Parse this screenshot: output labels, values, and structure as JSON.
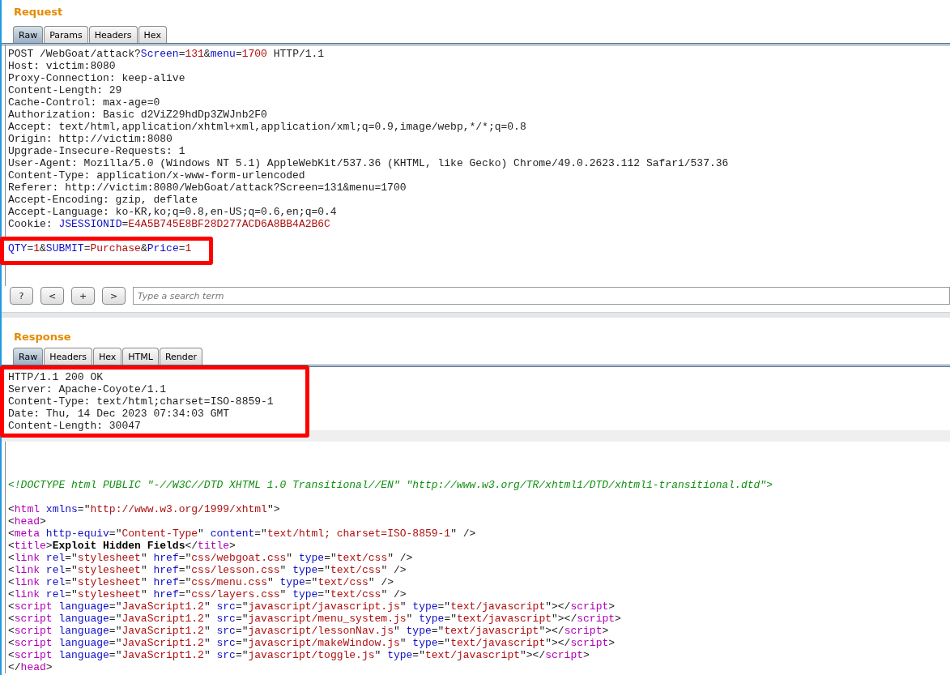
{
  "request": {
    "title": "Request",
    "tabs": [
      {
        "label": "Raw",
        "selected": true
      },
      {
        "label": "Params",
        "selected": false
      },
      {
        "label": "Headers",
        "selected": false
      },
      {
        "label": "Hex",
        "selected": false
      }
    ],
    "header_lines": [
      [
        {
          "kind": "plain",
          "text": "POST /WebGoat/attack?"
        },
        {
          "kind": "key",
          "text": "Screen"
        },
        {
          "kind": "plain",
          "text": "="
        },
        {
          "kind": "value",
          "text": "131"
        },
        {
          "kind": "plain",
          "text": "&"
        },
        {
          "kind": "key",
          "text": "menu"
        },
        {
          "kind": "plain",
          "text": "="
        },
        {
          "kind": "value",
          "text": "1700"
        },
        {
          "kind": "plain",
          "text": " HTTP/1.1"
        }
      ],
      [
        {
          "kind": "plain",
          "text": "Host: victim:8080"
        }
      ],
      [
        {
          "kind": "plain",
          "text": "Proxy-Connection: keep-alive"
        }
      ],
      [
        {
          "kind": "plain",
          "text": "Content-Length: 29"
        }
      ],
      [
        {
          "kind": "plain",
          "text": "Cache-Control: max-age=0"
        }
      ],
      [
        {
          "kind": "plain",
          "text": "Authorization: Basic d2ViZ29hdDp3ZWJnb2F0"
        }
      ],
      [
        {
          "kind": "plain",
          "text": "Accept: text/html,application/xhtml+xml,application/xml;q=0.9,image/webp,*/*;q=0.8"
        }
      ],
      [
        {
          "kind": "plain",
          "text": "Origin: http://victim:8080"
        }
      ],
      [
        {
          "kind": "plain",
          "text": "Upgrade-Insecure-Requests: 1"
        }
      ],
      [
        {
          "kind": "plain",
          "text": "User-Agent: Mozilla/5.0 (Windows NT 5.1) AppleWebKit/537.36 (KHTML, like Gecko) Chrome/49.0.2623.112 Safari/537.36"
        }
      ],
      [
        {
          "kind": "plain",
          "text": "Content-Type: application/x-www-form-urlencoded"
        }
      ],
      [
        {
          "kind": "plain",
          "text": "Referer: http://victim:8080/WebGoat/attack?Screen=131&menu=1700"
        }
      ],
      [
        {
          "kind": "plain",
          "text": "Accept-Encoding: gzip, deflate"
        }
      ],
      [
        {
          "kind": "plain",
          "text": "Accept-Language: ko-KR,ko;q=0.8,en-US;q=0.6,en;q=0.4"
        }
      ],
      [
        {
          "kind": "plain",
          "text": "Cookie: "
        },
        {
          "kind": "key",
          "text": "JSESSIONID"
        },
        {
          "kind": "plain",
          "text": "="
        },
        {
          "kind": "value",
          "text": "E4A5B745E8BF28D277ACD6A8BB4A2B6C"
        }
      ]
    ],
    "body_lines": [
      [
        {
          "kind": "key",
          "text": "QTY"
        },
        {
          "kind": "plain",
          "text": "="
        },
        {
          "kind": "value",
          "text": "1"
        },
        {
          "kind": "plain",
          "text": "&"
        },
        {
          "kind": "key",
          "text": "SUBMIT"
        },
        {
          "kind": "plain",
          "text": "="
        },
        {
          "kind": "value",
          "text": "Purchase"
        },
        {
          "kind": "plain",
          "text": "&"
        },
        {
          "kind": "key",
          "text": "Price"
        },
        {
          "kind": "plain",
          "text": "="
        },
        {
          "kind": "value",
          "text": "1"
        }
      ]
    ]
  },
  "toolbar": {
    "buttons": [
      "?",
      "<",
      "+",
      ">"
    ],
    "search": {
      "placeholder": "Type a search term"
    }
  },
  "response": {
    "title": "Response",
    "tabs": [
      {
        "label": "Raw",
        "selected": true
      },
      {
        "label": "Headers",
        "selected": false
      },
      {
        "label": "Hex",
        "selected": false
      },
      {
        "label": "HTML",
        "selected": false
      },
      {
        "label": "Render",
        "selected": false
      }
    ],
    "header_lines": [
      [
        {
          "kind": "plain",
          "text": "HTTP/1.1 200 OK"
        }
      ],
      [
        {
          "kind": "plain",
          "text": "Server: Apache-Coyote/1.1"
        }
      ],
      [
        {
          "kind": "plain",
          "text": "Content-Type: text/html;charset=ISO-8859-1"
        }
      ],
      [
        {
          "kind": "plain",
          "text": "Date: Thu, 14 Dec 2023 07:34:03 GMT"
        }
      ],
      [
        {
          "kind": "plain",
          "text": "Content-Length: 30047"
        }
      ]
    ],
    "doctype_line": [
      {
        "kind": "comment",
        "text": "<!DOCTYPE html PUBLIC \"-//W3C//DTD XHTML 1.0 Transitional//EN\" \"http://www.w3.org/TR/xhtml1/DTD/xhtml1-transitional.dtd\">"
      }
    ],
    "markup_lines": [
      [
        {
          "kind": "plain",
          "text": "<"
        },
        {
          "kind": "tag",
          "text": "html"
        },
        {
          "kind": "key",
          "text": " xmlns"
        },
        {
          "kind": "plain",
          "text": "=\""
        },
        {
          "kind": "value",
          "text": "http://www.w3.org/1999/xhtml"
        },
        {
          "kind": "plain",
          "text": "\">"
        }
      ],
      [
        {
          "kind": "plain",
          "text": "<"
        },
        {
          "kind": "tag",
          "text": "head"
        },
        {
          "kind": "plain",
          "text": ">"
        }
      ],
      [
        {
          "kind": "plain",
          "text": "<"
        },
        {
          "kind": "tag",
          "text": "meta"
        },
        {
          "kind": "key",
          "text": " http-equiv"
        },
        {
          "kind": "plain",
          "text": "=\""
        },
        {
          "kind": "value",
          "text": "Content-Type"
        },
        {
          "kind": "plain",
          "text": "\" "
        },
        {
          "kind": "key",
          "text": "content"
        },
        {
          "kind": "plain",
          "text": "=\""
        },
        {
          "kind": "value",
          "text": "text/html; charset=ISO-8859-1"
        },
        {
          "kind": "plain",
          "text": "\" />"
        }
      ],
      [
        {
          "kind": "plain",
          "text": "<"
        },
        {
          "kind": "tag",
          "text": "title"
        },
        {
          "kind": "plain",
          "text": ">"
        },
        {
          "kind": "bold",
          "text": "Exploit Hidden Fields"
        },
        {
          "kind": "plain",
          "text": "</"
        },
        {
          "kind": "tag",
          "text": "title"
        },
        {
          "kind": "plain",
          "text": ">"
        }
      ],
      [
        {
          "kind": "plain",
          "text": "<"
        },
        {
          "kind": "tag",
          "text": "link"
        },
        {
          "kind": "key",
          "text": " rel"
        },
        {
          "kind": "plain",
          "text": "=\""
        },
        {
          "kind": "value",
          "text": "stylesheet"
        },
        {
          "kind": "plain",
          "text": "\" "
        },
        {
          "kind": "key",
          "text": "href"
        },
        {
          "kind": "plain",
          "text": "=\""
        },
        {
          "kind": "value",
          "text": "css/webgoat.css"
        },
        {
          "kind": "plain",
          "text": "\" "
        },
        {
          "kind": "key",
          "text": "type"
        },
        {
          "kind": "plain",
          "text": "=\""
        },
        {
          "kind": "value",
          "text": "text/css"
        },
        {
          "kind": "plain",
          "text": "\" />"
        }
      ],
      [
        {
          "kind": "plain",
          "text": "<"
        },
        {
          "kind": "tag",
          "text": "link"
        },
        {
          "kind": "key",
          "text": " rel"
        },
        {
          "kind": "plain",
          "text": "=\""
        },
        {
          "kind": "value",
          "text": "stylesheet"
        },
        {
          "kind": "plain",
          "text": "\" "
        },
        {
          "kind": "key",
          "text": "href"
        },
        {
          "kind": "plain",
          "text": "=\""
        },
        {
          "kind": "value",
          "text": "css/lesson.css"
        },
        {
          "kind": "plain",
          "text": "\" "
        },
        {
          "kind": "key",
          "text": "type"
        },
        {
          "kind": "plain",
          "text": "=\""
        },
        {
          "kind": "value",
          "text": "text/css"
        },
        {
          "kind": "plain",
          "text": "\" />"
        }
      ],
      [
        {
          "kind": "plain",
          "text": "<"
        },
        {
          "kind": "tag",
          "text": "link"
        },
        {
          "kind": "key",
          "text": " rel"
        },
        {
          "kind": "plain",
          "text": "=\""
        },
        {
          "kind": "value",
          "text": "stylesheet"
        },
        {
          "kind": "plain",
          "text": "\" "
        },
        {
          "kind": "key",
          "text": "href"
        },
        {
          "kind": "plain",
          "text": "=\""
        },
        {
          "kind": "value",
          "text": "css/menu.css"
        },
        {
          "kind": "plain",
          "text": "\" "
        },
        {
          "kind": "key",
          "text": "type"
        },
        {
          "kind": "plain",
          "text": "=\""
        },
        {
          "kind": "value",
          "text": "text/css"
        },
        {
          "kind": "plain",
          "text": "\" />"
        }
      ],
      [
        {
          "kind": "plain",
          "text": "<"
        },
        {
          "kind": "tag",
          "text": "link"
        },
        {
          "kind": "key",
          "text": " rel"
        },
        {
          "kind": "plain",
          "text": "=\""
        },
        {
          "kind": "value",
          "text": "stylesheet"
        },
        {
          "kind": "plain",
          "text": "\" "
        },
        {
          "kind": "key",
          "text": "href"
        },
        {
          "kind": "plain",
          "text": "=\""
        },
        {
          "kind": "value",
          "text": "css/layers.css"
        },
        {
          "kind": "plain",
          "text": "\" "
        },
        {
          "kind": "key",
          "text": "type"
        },
        {
          "kind": "plain",
          "text": "=\""
        },
        {
          "kind": "value",
          "text": "text/css"
        },
        {
          "kind": "plain",
          "text": "\" />"
        }
      ],
      [
        {
          "kind": "plain",
          "text": "<"
        },
        {
          "kind": "tag",
          "text": "script"
        },
        {
          "kind": "key",
          "text": " language"
        },
        {
          "kind": "plain",
          "text": "=\""
        },
        {
          "kind": "value",
          "text": "JavaScript1.2"
        },
        {
          "kind": "plain",
          "text": "\" "
        },
        {
          "kind": "key",
          "text": "src"
        },
        {
          "kind": "plain",
          "text": "=\""
        },
        {
          "kind": "value",
          "text": "javascript/javascript.js"
        },
        {
          "kind": "plain",
          "text": "\" "
        },
        {
          "kind": "key",
          "text": "type"
        },
        {
          "kind": "plain",
          "text": "=\""
        },
        {
          "kind": "value",
          "text": "text/javascript"
        },
        {
          "kind": "plain",
          "text": "\"></"
        },
        {
          "kind": "tag",
          "text": "script"
        },
        {
          "kind": "plain",
          "text": ">"
        }
      ],
      [
        {
          "kind": "plain",
          "text": "<"
        },
        {
          "kind": "tag",
          "text": "script"
        },
        {
          "kind": "key",
          "text": " language"
        },
        {
          "kind": "plain",
          "text": "=\""
        },
        {
          "kind": "value",
          "text": "JavaScript1.2"
        },
        {
          "kind": "plain",
          "text": "\" "
        },
        {
          "kind": "key",
          "text": "src"
        },
        {
          "kind": "plain",
          "text": "=\""
        },
        {
          "kind": "value",
          "text": "javascript/menu_system.js"
        },
        {
          "kind": "plain",
          "text": "\" "
        },
        {
          "kind": "key",
          "text": "type"
        },
        {
          "kind": "plain",
          "text": "=\""
        },
        {
          "kind": "value",
          "text": "text/javascript"
        },
        {
          "kind": "plain",
          "text": "\"></"
        },
        {
          "kind": "tag",
          "text": "script"
        },
        {
          "kind": "plain",
          "text": ">"
        }
      ],
      [
        {
          "kind": "plain",
          "text": "<"
        },
        {
          "kind": "tag",
          "text": "script"
        },
        {
          "kind": "key",
          "text": " language"
        },
        {
          "kind": "plain",
          "text": "=\""
        },
        {
          "kind": "value",
          "text": "JavaScript1.2"
        },
        {
          "kind": "plain",
          "text": "\" "
        },
        {
          "kind": "key",
          "text": "src"
        },
        {
          "kind": "plain",
          "text": "=\""
        },
        {
          "kind": "value",
          "text": "javascript/lessonNav.js"
        },
        {
          "kind": "plain",
          "text": "\" "
        },
        {
          "kind": "key",
          "text": "type"
        },
        {
          "kind": "plain",
          "text": "=\""
        },
        {
          "kind": "value",
          "text": "text/javascript"
        },
        {
          "kind": "plain",
          "text": "\"></"
        },
        {
          "kind": "tag",
          "text": "script"
        },
        {
          "kind": "plain",
          "text": ">"
        }
      ],
      [
        {
          "kind": "plain",
          "text": "<"
        },
        {
          "kind": "tag",
          "text": "script"
        },
        {
          "kind": "key",
          "text": " language"
        },
        {
          "kind": "plain",
          "text": "=\""
        },
        {
          "kind": "value",
          "text": "JavaScript1.2"
        },
        {
          "kind": "plain",
          "text": "\" "
        },
        {
          "kind": "key",
          "text": "src"
        },
        {
          "kind": "plain",
          "text": "=\""
        },
        {
          "kind": "value",
          "text": "javascript/makeWindow.js"
        },
        {
          "kind": "plain",
          "text": "\" "
        },
        {
          "kind": "key",
          "text": "type"
        },
        {
          "kind": "plain",
          "text": "=\""
        },
        {
          "kind": "value",
          "text": "text/javascript"
        },
        {
          "kind": "plain",
          "text": "\"></"
        },
        {
          "kind": "tag",
          "text": "script"
        },
        {
          "kind": "plain",
          "text": ">"
        }
      ],
      [
        {
          "kind": "plain",
          "text": "<"
        },
        {
          "kind": "tag",
          "text": "script"
        },
        {
          "kind": "key",
          "text": " language"
        },
        {
          "kind": "plain",
          "text": "=\""
        },
        {
          "kind": "value",
          "text": "JavaScript1.2"
        },
        {
          "kind": "plain",
          "text": "\" "
        },
        {
          "kind": "key",
          "text": "src"
        },
        {
          "kind": "plain",
          "text": "=\""
        },
        {
          "kind": "value",
          "text": "javascript/toggle.js"
        },
        {
          "kind": "plain",
          "text": "\" "
        },
        {
          "kind": "key",
          "text": "type"
        },
        {
          "kind": "plain",
          "text": "=\""
        },
        {
          "kind": "value",
          "text": "text/javascript"
        },
        {
          "kind": "plain",
          "text": "\"></"
        },
        {
          "kind": "tag",
          "text": "script"
        },
        {
          "kind": "plain",
          "text": ">"
        }
      ],
      [
        {
          "kind": "plain",
          "text": "</"
        },
        {
          "kind": "tag",
          "text": "head"
        },
        {
          "kind": "plain",
          "text": ">"
        }
      ]
    ]
  }
}
